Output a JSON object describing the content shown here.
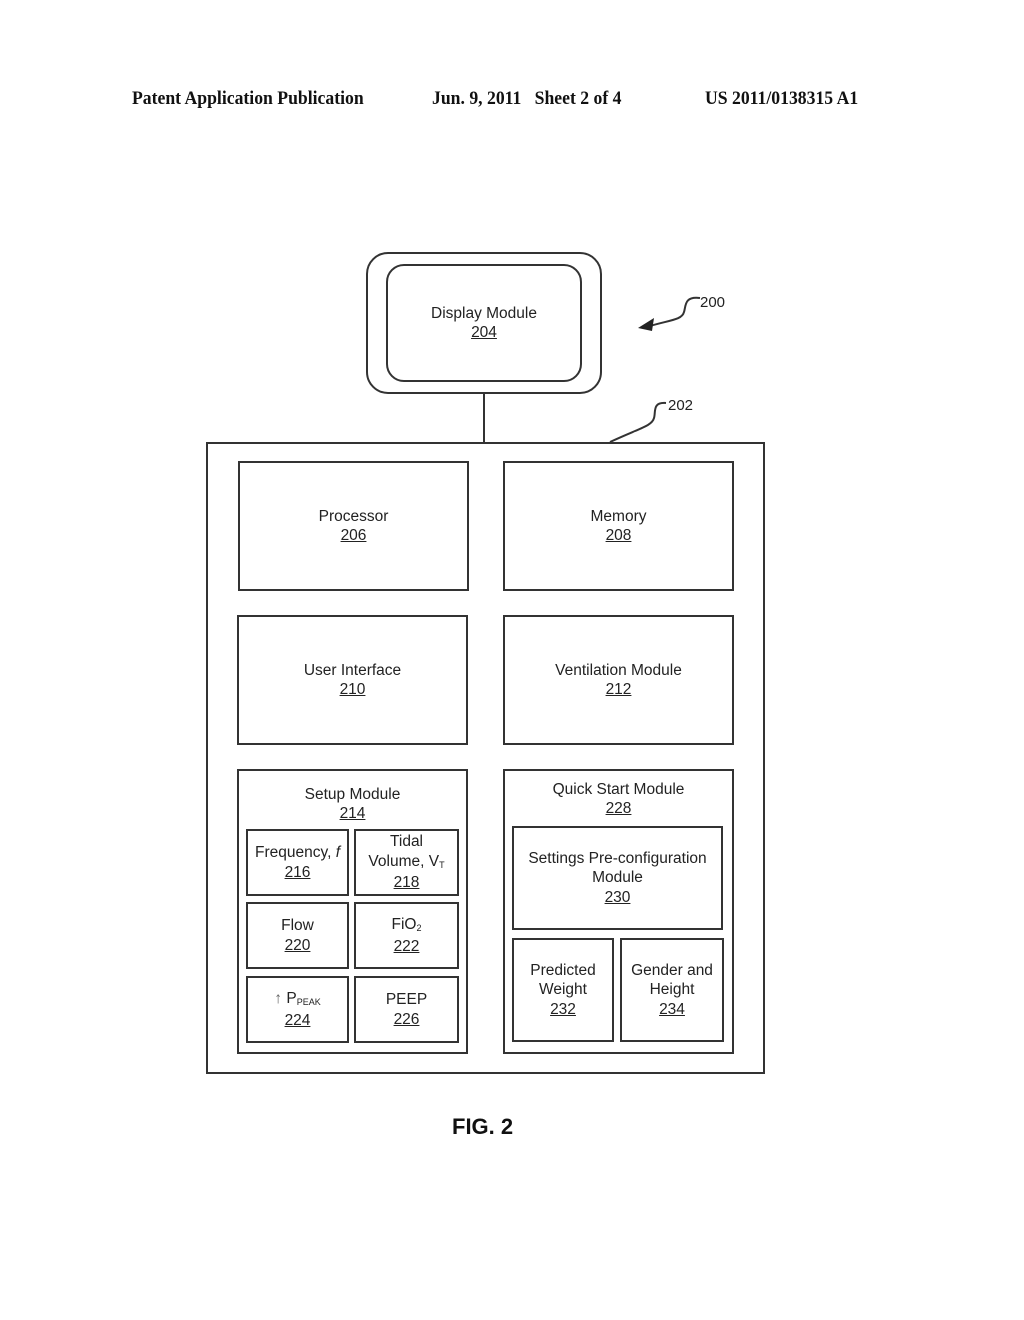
{
  "header": {
    "publication": "Patent Application Publication",
    "date_sheet": "Jun. 9, 2011   Sheet 2 of 4",
    "number": "US 2011/0138315 A1"
  },
  "refs": {
    "system": "200",
    "controller": "202"
  },
  "display": {
    "label": "Display Module",
    "num": "204"
  },
  "processor": {
    "label": "Processor",
    "num": "206"
  },
  "memory": {
    "label": "Memory",
    "num": "208"
  },
  "user_interface": {
    "label": "User Interface",
    "num": "210"
  },
  "ventilation": {
    "label": "Ventilation Module",
    "num": "212"
  },
  "setup": {
    "label": "Setup Module",
    "num": "214",
    "frequency": {
      "label": "Frequency, ",
      "sym": "f",
      "num": "216"
    },
    "tidal": {
      "label1": "Tidal",
      "label2": "Volume, V",
      "sub": "T",
      "num": "218"
    },
    "flow": {
      "label": "Flow",
      "num": "220"
    },
    "fio2": {
      "label": "FiO",
      "sub": "2",
      "num": "222"
    },
    "ppeak": {
      "arrow": "↑",
      "label": "P",
      "sub": "PEAK",
      "num": "224"
    },
    "peep": {
      "label": "PEEP",
      "num": "226"
    }
  },
  "quick_start": {
    "label": "Quick Start Module",
    "num": "228",
    "settings": {
      "label1": "Settings Pre-configuration",
      "label2": "Module",
      "num": "230"
    },
    "predicted": {
      "label1": "Predicted",
      "label2": "Weight",
      "num": "232"
    },
    "gender": {
      "label1": "Gender and",
      "label2": "Height",
      "num": "234"
    }
  },
  "figure_label": "FIG. 2"
}
